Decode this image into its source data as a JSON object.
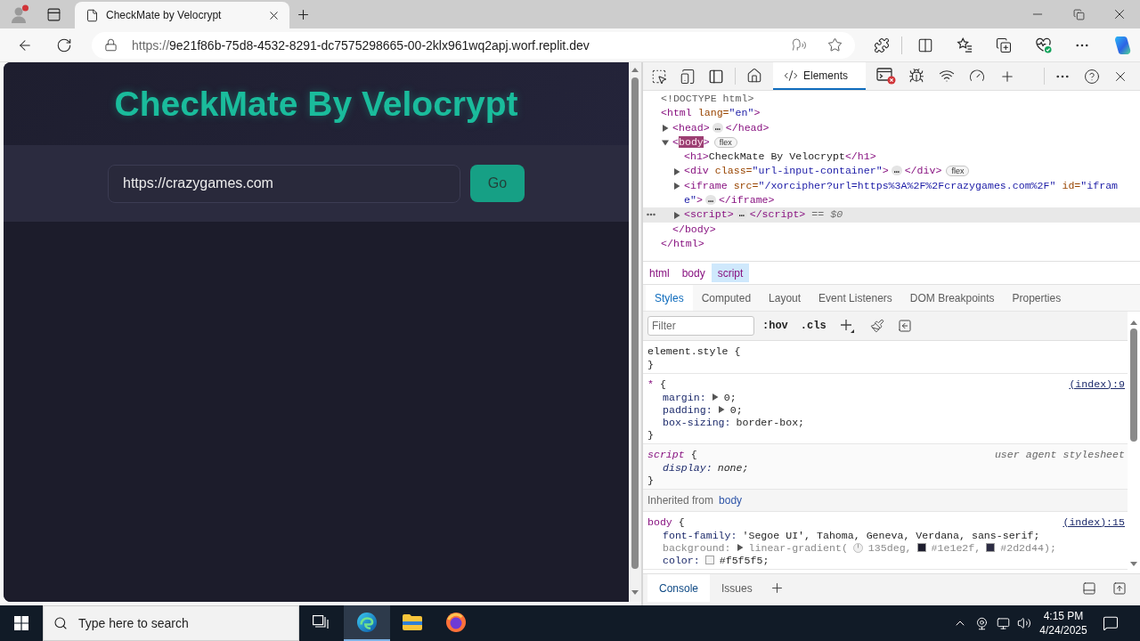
{
  "browser": {
    "profile": {
      "notification": true
    },
    "tabs": [
      {
        "title": "CheckMate by Velocrypt",
        "selected": true
      }
    ],
    "address": {
      "scheme": "https://",
      "host": "9e21f86b-75d8-4532-8291-dc7575298665-00-2klx961wq2apj.worf.replit.dev"
    }
  },
  "page": {
    "title": "CheckMate By Velocrypt",
    "url_input": {
      "value": "https://crazygames.com"
    },
    "go_button": "Go"
  },
  "devtools": {
    "tabs": [
      {
        "kind": "welcome",
        "selected": false
      },
      {
        "kind": "elements",
        "label": "Elements",
        "selected": true
      },
      {
        "kind": "console",
        "selected": false,
        "alert": true
      },
      {
        "kind": "sources",
        "selected": false
      },
      {
        "kind": "network",
        "selected": false
      },
      {
        "kind": "performance",
        "selected": false
      }
    ],
    "dom_tree": [
      {
        "selected": false,
        "tokens": [
          {
            "kind": "doctype",
            "text": "<!DOCTYPE html>"
          }
        ]
      },
      {
        "selected": false,
        "tokens": [
          {
            "kind": "tag",
            "text": "<html"
          },
          {
            "kind": "attr",
            "text": " lang="
          },
          {
            "kind": "value",
            "text": "\"en\""
          },
          {
            "kind": "tag",
            "text": ">"
          }
        ],
        "children": [
          {
            "selected": false,
            "expanded": false,
            "tokens": [
              {
                "kind": "tag",
                "text": "<head>"
              },
              {
                "kind": "ellipsis",
                "text": "…"
              },
              {
                "kind": "tag",
                "text": "</head>"
              }
            ]
          },
          {
            "selected": false,
            "expanded": true,
            "badge": "flex",
            "tokens": [
              {
                "kind": "tag",
                "text": "<"
              },
              {
                "kind": "match",
                "text": "body"
              },
              {
                "kind": "tag",
                "text": ">"
              }
            ],
            "children": [
              {
                "selected": false,
                "tokens": [
                  {
                    "kind": "tag",
                    "text": "<h1>"
                  },
                  {
                    "kind": "text",
                    "text": "CheckMate By Velocrypt"
                  },
                  {
                    "kind": "tag",
                    "text": "</h1>"
                  }
                ]
              },
              {
                "selected": false,
                "expanded": false,
                "badge": "flex",
                "tokens": [
                  {
                    "kind": "tag",
                    "text": "<div"
                  },
                  {
                    "kind": "attr",
                    "text": " class="
                  },
                  {
                    "kind": "value",
                    "text": "\"url-input-container\""
                  },
                  {
                    "kind": "tag",
                    "text": ">"
                  },
                  {
                    "kind": "ellipsis",
                    "text": "…"
                  },
                  {
                    "kind": "tag",
                    "text": "</div>"
                  }
                ]
              },
              {
                "selected": false,
                "expanded": false,
                "tokens": [
                  {
                    "kind": "tag",
                    "text": "<iframe"
                  },
                  {
                    "kind": "attr",
                    "text": " src="
                  },
                  {
                    "kind": "value",
                    "text": "\"/xorcipher?url=https%3A%2F%2Fcrazygames.com%2F\""
                  },
                  {
                    "kind": "attr",
                    "text": " id="
                  },
                  {
                    "kind": "value",
                    "text": "\"iframe\""
                  },
                  {
                    "kind": "tag",
                    "text": ">"
                  },
                  {
                    "kind": "ellipsis",
                    "text": "…"
                  },
                  {
                    "kind": "tag",
                    "text": "</iframe>"
                  }
                ]
              },
              {
                "selected": true,
                "expanded": false,
                "tokens": [
                  {
                    "kind": "tag",
                    "text": "<script>"
                  },
                  {
                    "kind": "ellipsis",
                    "text": "…"
                  },
                  {
                    "kind": "tag",
                    "text": "</script>"
                  },
                  {
                    "kind": "marker",
                    "text": "== $0"
                  }
                ]
              }
            ],
            "closing": [
              {
                "kind": "tag",
                "text": "</body>"
              }
            ]
          }
        ],
        "closing": [
          {
            "kind": "tag",
            "text": "</html>"
          }
        ]
      }
    ],
    "breadcrumbs": [
      {
        "label": "html",
        "selected": false
      },
      {
        "label": "body",
        "selected": false
      },
      {
        "label": "script",
        "selected": true
      }
    ],
    "panel_tabs": [
      {
        "label": "Styles",
        "selected": true
      },
      {
        "label": "Computed",
        "selected": false
      },
      {
        "label": "Layout",
        "selected": false
      },
      {
        "label": "Event Listeners",
        "selected": false
      },
      {
        "label": "DOM Breakpoints",
        "selected": false
      },
      {
        "label": "Properties",
        "selected": false
      }
    ],
    "filter": {
      "placeholder": "Filter"
    },
    "filter_buttons": [
      ":hov",
      ".cls"
    ],
    "style_sections": [
      {
        "kind": "inline",
        "selector": "element.style",
        "open": "{",
        "close": "}"
      },
      {
        "kind": "author",
        "selector": "*",
        "open": "{",
        "source": "(index):9",
        "declarations": [
          {
            "name": "margin:",
            "inactive": false,
            "expanded": false,
            "value": [
              {
                "kind": "text",
                "text": "0;"
              }
            ]
          },
          {
            "name": "padding:",
            "inactive": false,
            "expanded": false,
            "value": [
              {
                "kind": "text",
                "text": "0;"
              }
            ]
          },
          {
            "name": "box-sizing:",
            "inactive": false,
            "value": [
              {
                "kind": "text",
                "text": "border-box;"
              }
            ]
          }
        ],
        "close": "}"
      },
      {
        "kind": "useragent",
        "selector": "script",
        "open": "{",
        "source": "user agent stylesheet",
        "declarations": [
          {
            "name": "display:",
            "inactive": false,
            "value": [
              {
                "kind": "text",
                "text": "none;"
              }
            ]
          }
        ],
        "close": "}"
      },
      {
        "kind": "inherited",
        "label": "Inherited from",
        "link": "body"
      },
      {
        "kind": "author",
        "selector": "body",
        "open": "{",
        "source": "(index):15",
        "declarations": [
          {
            "name": "font-family:",
            "inactive": false,
            "value": [
              {
                "kind": "text",
                "text": "'Segoe UI', Tahoma, Geneva, Verdana, sans-serif;"
              }
            ]
          },
          {
            "name": "background:",
            "inactive": true,
            "expanded": false,
            "value": [
              {
                "kind": "text",
                "text": "linear-gradient("
              },
              {
                "kind": "angle"
              },
              {
                "kind": "text",
                "text": "135deg,"
              },
              {
                "kind": "swatch",
                "color": "#1e1e2f"
              },
              {
                "kind": "text",
                "text": "#1e1e2f,"
              },
              {
                "kind": "swatch",
                "color": "#2d2d44"
              },
              {
                "kind": "text",
                "text": "#2d2d44);"
              }
            ]
          },
          {
            "name": "color:",
            "inactive": false,
            "value": [
              {
                "kind": "swatch",
                "color": "#f5f5f5"
              },
              {
                "kind": "text",
                "text": "#f5f5f5;"
              }
            ]
          }
        ]
      }
    ],
    "drawer_tabs": [
      {
        "label": "Console",
        "selected": true
      },
      {
        "label": "Issues",
        "selected": false
      }
    ]
  },
  "taskbar": {
    "search": {
      "placeholder": "Type here to search"
    },
    "apps": [
      {
        "kind": "task-view",
        "selected": false
      },
      {
        "kind": "edge",
        "selected": true
      },
      {
        "kind": "file-explorer",
        "selected": false
      },
      {
        "kind": "firefox",
        "selected": false
      }
    ],
    "time": "4:15 PM",
    "date": "4/24/2025"
  }
}
